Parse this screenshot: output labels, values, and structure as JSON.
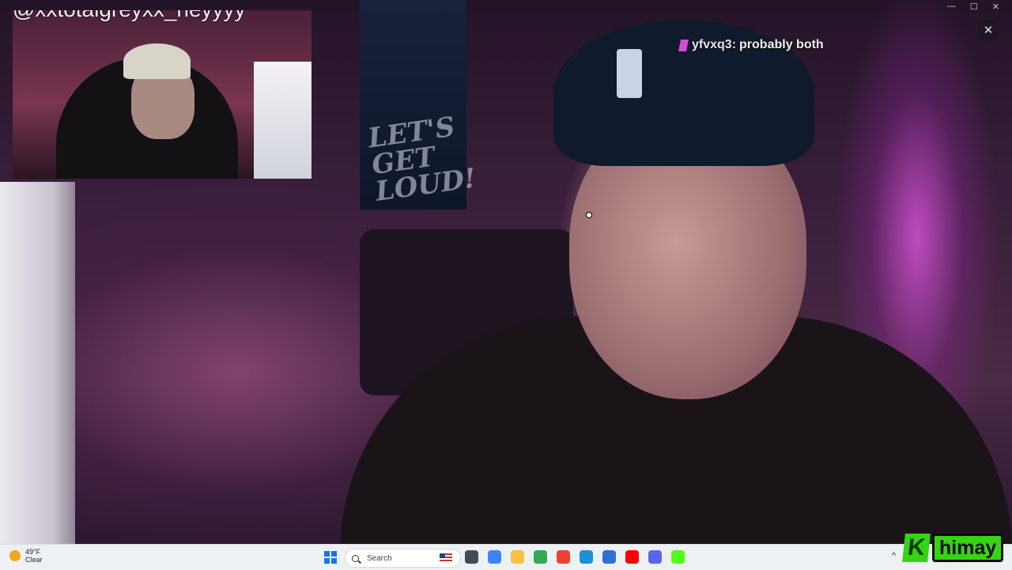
{
  "overlay": {
    "channel_text": "@xxtotalgreyxx_heyyyy",
    "chat": {
      "username": "yfvxq3:",
      "message": "probably both",
      "badge_color": "#d64ad6"
    }
  },
  "scene": {
    "poster_text": "LET'S GET LOUD!"
  },
  "window": {
    "minimize": "—",
    "maximize": "☐",
    "close": "✕",
    "overlay_close": "✕"
  },
  "taskbar": {
    "weather": {
      "temp": "49°F",
      "condition": "Clear",
      "icon": "moon-icon"
    },
    "search_label": "Search",
    "apps": [
      {
        "name": "task-view",
        "color": "#444b55"
      },
      {
        "name": "copilot",
        "color": "#3a86ff"
      },
      {
        "name": "file-explorer",
        "color": "#f5c242"
      },
      {
        "name": "chrome",
        "color": "#34a853"
      },
      {
        "name": "chrome-alt",
        "color": "#ea4335"
      },
      {
        "name": "edge",
        "color": "#1e90d6"
      },
      {
        "name": "store",
        "color": "#2f6fd6"
      },
      {
        "name": "youtube",
        "color": "#ff0000"
      },
      {
        "name": "discord",
        "color": "#5865f2"
      },
      {
        "name": "kick",
        "color": "#53fc18"
      }
    ],
    "tray_chevron": "^"
  },
  "branding": {
    "logo_letter": "K",
    "logo_name": "himay",
    "brand_color": "#35d415"
  }
}
